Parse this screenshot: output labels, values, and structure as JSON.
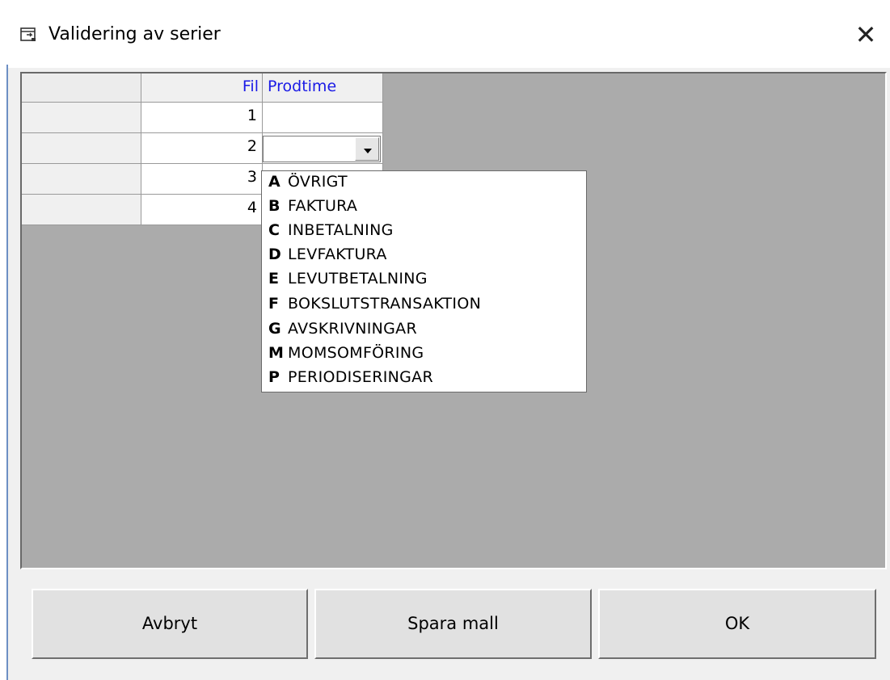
{
  "window": {
    "title": "Validering av serier",
    "close_glyph": "✕",
    "icon": "window-app-icon"
  },
  "grid": {
    "columns": [
      {
        "header": ""
      },
      {
        "header": "Fil"
      },
      {
        "header": "Prodtime"
      }
    ],
    "rows": [
      {
        "fil": "1",
        "prodtime": ""
      },
      {
        "fil": "2",
        "prodtime": ""
      },
      {
        "fil": "3",
        "prodtime": ""
      },
      {
        "fil": "4",
        "prodtime": ""
      }
    ],
    "header_text_color": "#1a1ae6",
    "background_color": "#ababab"
  },
  "dropdown": {
    "selected": "",
    "options": [
      {
        "key": "A",
        "label": "ÖVRIGT"
      },
      {
        "key": "B",
        "label": "FAKTURA"
      },
      {
        "key": "C",
        "label": "INBETALNING"
      },
      {
        "key": "D",
        "label": "LEVFAKTURA"
      },
      {
        "key": "E",
        "label": "LEVUTBETALNING"
      },
      {
        "key": "F",
        "label": "BOKSLUTSTRANSAKTION"
      },
      {
        "key": "G",
        "label": "AVSKRIVNINGAR"
      },
      {
        "key": "M",
        "label": "MOMSOMFÖRING"
      },
      {
        "key": "P",
        "label": "PERIODISERINGAR"
      }
    ]
  },
  "buttons": {
    "cancel": "Avbryt",
    "save_template": "Spara mall",
    "ok": "OK"
  }
}
